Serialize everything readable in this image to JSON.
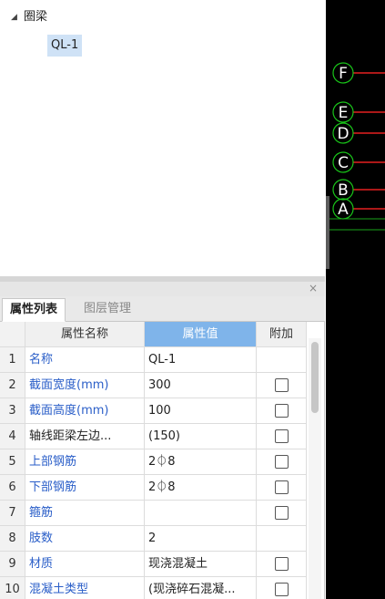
{
  "tree": {
    "root_label": "圈梁",
    "child_label": "QL-1"
  },
  "panel": {
    "close_glyph": "×",
    "tabs": [
      {
        "label": "属性列表"
      },
      {
        "label": "图层管理"
      }
    ]
  },
  "table": {
    "headers": {
      "name": "属性名称",
      "value": "属性值",
      "extra": "附加"
    },
    "rows": [
      {
        "idx": "1",
        "name": "名称",
        "value": "QL-1",
        "checkbox": false,
        "blue": true
      },
      {
        "idx": "2",
        "name": "截面宽度(mm)",
        "value": "300",
        "checkbox": true,
        "blue": true
      },
      {
        "idx": "3",
        "name": "截面高度(mm)",
        "value": "100",
        "checkbox": true,
        "blue": true
      },
      {
        "idx": "4",
        "name": "轴线距梁左边...",
        "value": "(150)",
        "checkbox": true,
        "blue": false
      },
      {
        "idx": "5",
        "name": "上部钢筋",
        "value": "2⏀8",
        "checkbox": true,
        "blue": true
      },
      {
        "idx": "6",
        "name": "下部钢筋",
        "value": "2⏀8",
        "checkbox": true,
        "blue": true
      },
      {
        "idx": "7",
        "name": "箍筋",
        "value": "",
        "checkbox": true,
        "blue": true
      },
      {
        "idx": "8",
        "name": "肢数",
        "value": "2",
        "checkbox": false,
        "blue": true
      },
      {
        "idx": "9",
        "name": "材质",
        "value": "现浇混凝土",
        "checkbox": true,
        "blue": true
      },
      {
        "idx": "10",
        "name": "混凝土类型",
        "value": "(现浇碎石混凝...",
        "checkbox": true,
        "blue": true
      }
    ]
  },
  "axes": [
    {
      "label": "F"
    },
    {
      "label": "E"
    },
    {
      "label": "D"
    },
    {
      "label": "C"
    },
    {
      "label": "B"
    },
    {
      "label": "A"
    }
  ],
  "colors": {
    "axis_circle": "#19c419",
    "axis_line": "#e52020",
    "green_line": "#1aa51a",
    "selected_header": "#7fb4ea",
    "link_text": "#2a5ec8"
  }
}
